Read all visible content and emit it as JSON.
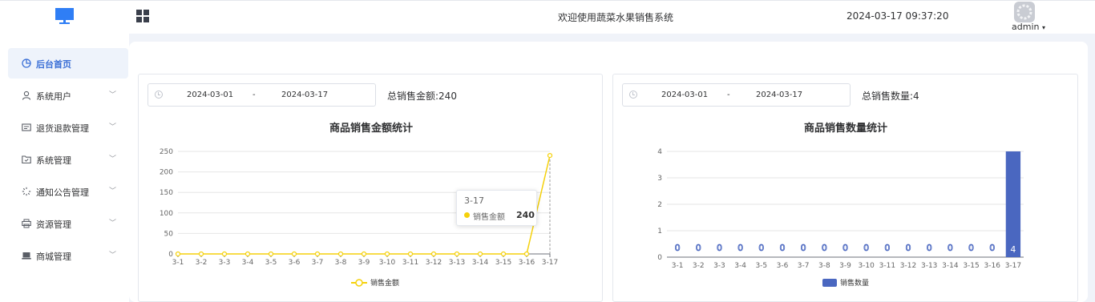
{
  "header": {
    "welcome": "欢迎使用蔬菜水果销售系统",
    "datetime": "2024-03-17 09:37:20",
    "username": "admin",
    "logo_icon": "monitor-icon",
    "menu_toggle_icon": "grid-icon"
  },
  "sidebar": {
    "items": [
      {
        "label": "后台首页",
        "icon": "pie-chart-icon",
        "active": true
      },
      {
        "label": "系统用户",
        "icon": "user-icon"
      },
      {
        "label": "退货退款管理",
        "icon": "ticket-icon"
      },
      {
        "label": "系统管理",
        "icon": "folder-check-icon"
      },
      {
        "label": "通知公告管理",
        "icon": "loading-icon"
      },
      {
        "label": "资源管理",
        "icon": "printer-icon"
      },
      {
        "label": "商城管理",
        "icon": "laptop-icon"
      }
    ]
  },
  "panels": [
    {
      "date_start": "2024-03-01",
      "date_sep": "-",
      "date_end": "2024-03-17",
      "total_label": "总销售金额:",
      "total_value": "240",
      "title": "商品销售金额统计"
    },
    {
      "date_start": "2024-03-01",
      "date_sep": "-",
      "date_end": "2024-03-17",
      "total_label": "总销售数量:",
      "total_value": "4",
      "title": "商品销售数量统计"
    }
  ],
  "tooltip": {
    "x": "3-17",
    "name": "销售金额",
    "value": "240"
  },
  "chart_data": [
    {
      "type": "line",
      "title": "商品销售金额统计",
      "categories": [
        "3-1",
        "3-2",
        "3-3",
        "3-4",
        "3-5",
        "3-6",
        "3-7",
        "3-8",
        "3-9",
        "3-10",
        "3-11",
        "3-12",
        "3-13",
        "3-14",
        "3-15",
        "3-16",
        "3-17"
      ],
      "series": [
        {
          "name": "销售金额",
          "values": [
            0,
            0,
            0,
            0,
            0,
            0,
            0,
            0,
            0,
            0,
            0,
            0,
            0,
            0,
            0,
            0,
            240
          ]
        }
      ],
      "yticks": [
        "0",
        "50",
        "100",
        "150",
        "200",
        "250"
      ],
      "ylim": [
        0,
        250
      ],
      "color": "#f5d10b",
      "grid": true,
      "legend": "bottom-center"
    },
    {
      "type": "bar",
      "title": "商品销售数量统计",
      "categories": [
        "3-1",
        "3-2",
        "3-3",
        "3-4",
        "3-5",
        "3-6",
        "3-7",
        "3-8",
        "3-9",
        "3-10",
        "3-11",
        "3-12",
        "3-13",
        "3-14",
        "3-15",
        "3-16",
        "3-17"
      ],
      "series": [
        {
          "name": "销售数量",
          "values": [
            0,
            0,
            0,
            0,
            0,
            0,
            0,
            0,
            0,
            0,
            0,
            0,
            0,
            0,
            0,
            0,
            4
          ]
        }
      ],
      "yticks": [
        "0",
        "1",
        "2",
        "3",
        "4"
      ],
      "ylim": [
        0,
        4
      ],
      "color": "#4a67c0",
      "grid": true,
      "legend": "bottom-center"
    }
  ]
}
